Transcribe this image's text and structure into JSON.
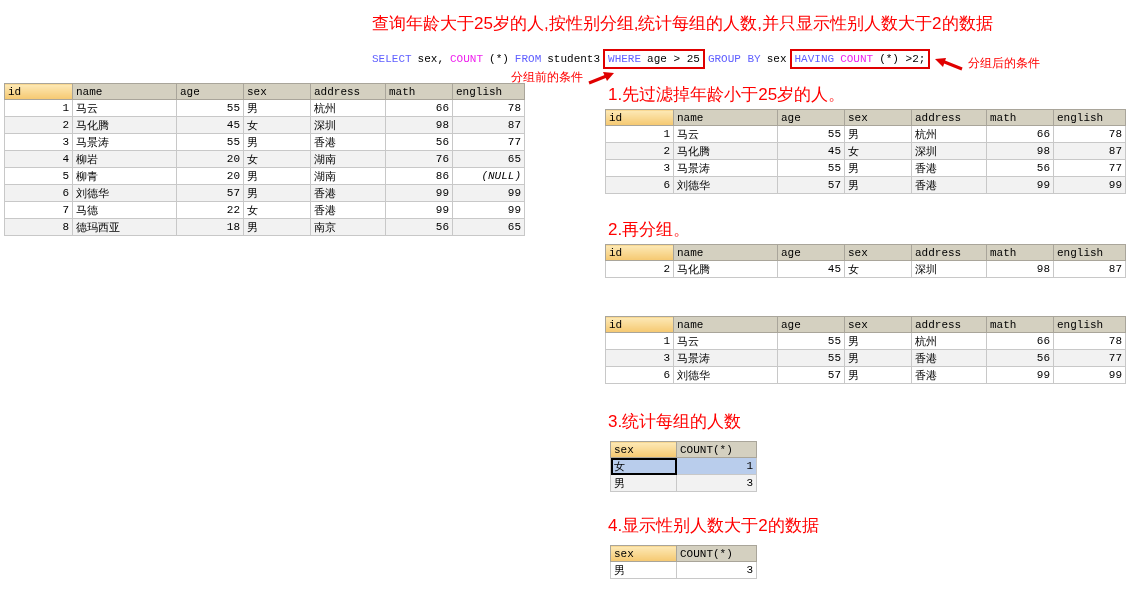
{
  "title": "查询年龄大于25岁的人,按性别分组,统计每组的人数,并只显示性别人数大于2的数据",
  "sql": [
    {
      "tokens": [
        {
          "kind": "keyword",
          "text": "SELECT"
        },
        {
          "kind": "plain",
          "text": "sex,"
        },
        {
          "kind": "function",
          "text": "COUNT"
        },
        {
          "kind": "plain",
          "text": "(*)"
        },
        {
          "kind": "keyword",
          "text": "FROM"
        },
        {
          "kind": "plain",
          "text": "student3"
        }
      ]
    },
    {
      "boxed": true,
      "note": "分组前的条件",
      "tokens": [
        {
          "kind": "keyword",
          "text": "WHERE"
        },
        {
          "kind": "plain",
          "text": "age > 25"
        }
      ]
    },
    {
      "tokens": [
        {
          "kind": "keyword",
          "text": "GROUP BY"
        },
        {
          "kind": "plain",
          "text": "sex"
        }
      ]
    },
    {
      "boxed": true,
      "note": "分组后的条件",
      "tokens": [
        {
          "kind": "keyword",
          "text": "HAVING"
        },
        {
          "kind": "function",
          "text": "COUNT"
        },
        {
          "kind": "plain",
          "text": "(*) >2;"
        }
      ]
    }
  ],
  "source_table": {
    "columns": [
      {
        "label": "id",
        "kind": "number",
        "selected": true
      },
      {
        "label": "name",
        "kind": "text",
        "selected": false
      },
      {
        "label": "age",
        "kind": "number",
        "selected": false
      },
      {
        "label": "sex",
        "kind": "text",
        "selected": false
      },
      {
        "label": "address",
        "kind": "text",
        "selected": false
      },
      {
        "label": "math",
        "kind": "number",
        "selected": false
      },
      {
        "label": "english",
        "kind": "number",
        "selected": false
      }
    ],
    "rows": [
      {
        "cells": [
          "1",
          "马云",
          "55",
          "男",
          "杭州",
          "66",
          "78"
        ]
      },
      {
        "cells": [
          "2",
          "马化腾",
          "45",
          "女",
          "深圳",
          "98",
          "87"
        ]
      },
      {
        "cells": [
          "3",
          "马景涛",
          "55",
          "男",
          "香港",
          "56",
          "77"
        ]
      },
      {
        "cells": [
          "4",
          "柳岩",
          "20",
          "女",
          "湖南",
          "76",
          "65"
        ]
      },
      {
        "cells": [
          "5",
          "柳青",
          "20",
          "男",
          "湖南",
          "86",
          {
            "kind": "null",
            "text": "(NULL)"
          }
        ]
      },
      {
        "cells": [
          "6",
          "刘德华",
          "57",
          "男",
          "香港",
          "99",
          "99"
        ]
      },
      {
        "cells": [
          "7",
          "马德",
          "22",
          "女",
          "香港",
          "99",
          "99"
        ]
      },
      {
        "cells": [
          "8",
          "德玛西亚",
          "18",
          "男",
          "南京",
          "56",
          "65"
        ]
      }
    ]
  },
  "steps": [
    {
      "heading": "1.先过滤掉年龄小于25岁的人。",
      "tables": [
        {
          "columns": [
            {
              "label": "id",
              "kind": "number",
              "selected": true
            },
            {
              "label": "name",
              "kind": "text",
              "selected": false
            },
            {
              "label": "age",
              "kind": "number",
              "selected": false
            },
            {
              "label": "sex",
              "kind": "text",
              "selected": false
            },
            {
              "label": "address",
              "kind": "text",
              "selected": false
            },
            {
              "label": "math",
              "kind": "number",
              "selected": false
            },
            {
              "label": "english",
              "kind": "number",
              "selected": false
            }
          ],
          "rows": [
            {
              "cells": [
                "1",
                "马云",
                "55",
                "男",
                "杭州",
                "66",
                "78"
              ]
            },
            {
              "cells": [
                "2",
                "马化腾",
                "45",
                "女",
                "深圳",
                "98",
                "87"
              ]
            },
            {
              "cells": [
                "3",
                "马景涛",
                "55",
                "男",
                "香港",
                "56",
                "77"
              ]
            },
            {
              "cells": [
                "6",
                "刘德华",
                "57",
                "男",
                "香港",
                "99",
                "99"
              ]
            }
          ]
        }
      ]
    },
    {
      "heading": "2.再分组。",
      "tables": [
        {
          "columns": [
            {
              "label": "id",
              "kind": "number",
              "selected": true
            },
            {
              "label": "name",
              "kind": "text",
              "selected": false
            },
            {
              "label": "age",
              "kind": "number",
              "selected": false
            },
            {
              "label": "sex",
              "kind": "text",
              "selected": false
            },
            {
              "label": "address",
              "kind": "text",
              "selected": false
            },
            {
              "label": "math",
              "kind": "number",
              "selected": false
            },
            {
              "label": "english",
              "kind": "number",
              "selected": false
            }
          ],
          "rows": [
            {
              "cells": [
                "2",
                "马化腾",
                "45",
                "女",
                "深圳",
                "98",
                "87"
              ]
            }
          ]
        },
        {
          "columns": [
            {
              "label": "id",
              "kind": "number",
              "selected": true
            },
            {
              "label": "name",
              "kind": "text",
              "selected": false
            },
            {
              "label": "age",
              "kind": "number",
              "selected": false
            },
            {
              "label": "sex",
              "kind": "text",
              "selected": false
            },
            {
              "label": "address",
              "kind": "text",
              "selected": false
            },
            {
              "label": "math",
              "kind": "number",
              "selected": false
            },
            {
              "label": "english",
              "kind": "number",
              "selected": false
            }
          ],
          "rows": [
            {
              "cells": [
                "1",
                "马云",
                "55",
                "男",
                "杭州",
                "66",
                "78"
              ]
            },
            {
              "cells": [
                "3",
                "马景涛",
                "55",
                "男",
                "香港",
                "56",
                "77"
              ]
            },
            {
              "cells": [
                "6",
                "刘德华",
                "57",
                "男",
                "香港",
                "99",
                "99"
              ]
            }
          ]
        }
      ]
    },
    {
      "heading": "3.统计每组的人数",
      "tables": [
        {
          "columns": [
            {
              "label": "sex",
              "kind": "text",
              "selected": true
            },
            {
              "label": "COUNT(*)",
              "kind": "number",
              "selected": false
            }
          ],
          "rows": [
            {
              "selected": true,
              "cells": [
                "女",
                "1"
              ]
            },
            {
              "selected": false,
              "cells": [
                "男",
                "3"
              ]
            }
          ]
        }
      ]
    },
    {
      "heading": "4.显示性别人数大于2的数据",
      "tables": [
        {
          "columns": [
            {
              "label": "sex",
              "kind": "text",
              "selected": true
            },
            {
              "label": "COUNT(*)",
              "kind": "number",
              "selected": false
            }
          ],
          "rows": [
            {
              "cells": [
                "男",
                "3"
              ]
            }
          ]
        }
      ]
    }
  ]
}
